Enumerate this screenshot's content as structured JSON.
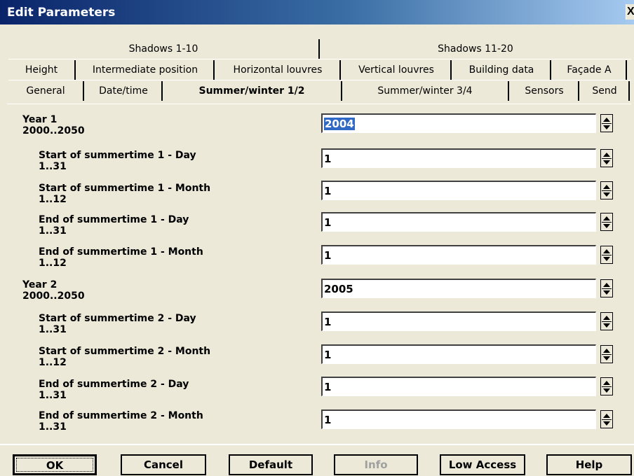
{
  "window": {
    "title": "Edit Parameters",
    "close_glyph": "X"
  },
  "tabs": {
    "row1": [
      "Shadows 1-10",
      "Shadows 11-20"
    ],
    "row2": [
      "Height",
      "Intermediate position",
      "Horizontal louvres",
      "Vertical louvres",
      "Building data",
      "Façade A"
    ],
    "row3": [
      "General",
      "Date/time",
      "Summer/winter 1/2",
      "Summer/winter 3/4",
      "Sensors",
      "Send"
    ],
    "active": "Summer/winter 1/2"
  },
  "params": [
    {
      "label": "Year 1",
      "range": "2000..2050",
      "value": "2004",
      "selected": true
    },
    {
      "label": "Start of summertime 1 - Day",
      "range": "1..31",
      "value": "1"
    },
    {
      "label": "Start of summertime 1 - Month",
      "range": "1..12",
      "value": "1"
    },
    {
      "label": "End of summertime 1 - Day",
      "range": "1..31",
      "value": "1"
    },
    {
      "label": "End of summertime 1 - Month",
      "range": "1..12",
      "value": "1"
    },
    {
      "label": "Year 2",
      "range": "2000..2050",
      "value": "2005"
    },
    {
      "label": "Start of summertime 2 - Day",
      "range": "1..31",
      "value": "1"
    },
    {
      "label": "Start of summertime 2 - Month",
      "range": "1..12",
      "value": "1"
    },
    {
      "label": "End of summertime 2 - Day",
      "range": "1..31",
      "value": "1"
    },
    {
      "label": "End of summertime 2 - Month",
      "range": "1..31",
      "value": "1"
    }
  ],
  "buttons": {
    "ok": "OK",
    "cancel": "Cancel",
    "default": "Default",
    "info": "Info",
    "low_access": "Low Access",
    "help": "Help"
  }
}
